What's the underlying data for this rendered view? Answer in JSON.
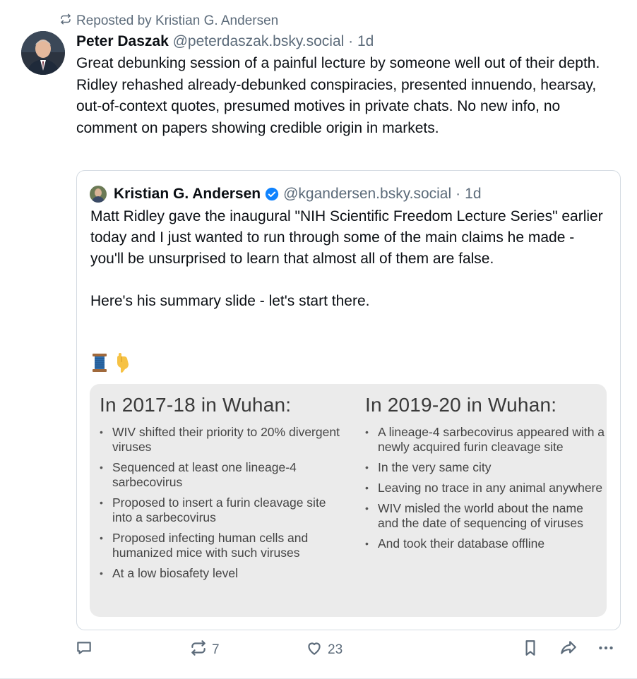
{
  "repost": {
    "icon": "repost-icon",
    "label": "Reposted by Kristian G. Andersen"
  },
  "post": {
    "author": "Peter Daszak",
    "handle": "@peterdaszak.bsky.social",
    "separator": "·",
    "time": "1d",
    "text": "Great debunking session of a painful lecture by someone well out of their depth. Ridley rehashed already-debunked conspiracies, presented innuendo, hearsay, out-of-context quotes, presumed motives in private chats. No new info, no comment on papers showing credible origin in markets."
  },
  "quote": {
    "author": "Kristian G. Andersen",
    "handle": "@kgandersen.bsky.social",
    "separator": "·",
    "time": "1d",
    "verified_icon": "verified-badge-icon",
    "paragraph1": "Matt Ridley gave the inaugural \"NIH Scientific Freedom Lecture Series\" earlier today and I just wanted to run through some of the main claims he made - you'll be unsurprised to learn that almost all of them are false.",
    "paragraph2": "Here's his summary slide - let's start there.",
    "emojis": [
      "thread-spool-emoji",
      "pointing-down-emoji"
    ],
    "slide": {
      "left_title": "In 2017-18 in Wuhan:",
      "left_items": [
        "WIV shifted their priority to 20% divergent viruses",
        "Sequenced at least one lineage-4 sarbecovirus",
        "Proposed to insert a furin cleavage site into a sarbecovirus",
        "Proposed infecting human cells and humanized mice with such viruses",
        "At a low biosafety level"
      ],
      "right_title": "In 2019-20 in Wuhan:",
      "right_items": [
        "A lineage-4 sarbecovirus appeared with a newly acquired furin cleavage site",
        "In the very same city",
        "Leaving no trace in any animal anywhere",
        "WIV misled the world about the name and the date of sequencing of viruses",
        "And took their database offline"
      ]
    }
  },
  "actions": {
    "reply_icon": "reply-icon",
    "repost_icon": "repost-icon",
    "repost_count": "7",
    "like_icon": "heart-icon",
    "like_count": "23",
    "bookmark_icon": "bookmark-icon",
    "share_icon": "share-icon",
    "more_icon": "more-icon"
  },
  "colors": {
    "muted": "#5c6b7a",
    "verified": "#1083fe",
    "text": "#0b0f14"
  }
}
